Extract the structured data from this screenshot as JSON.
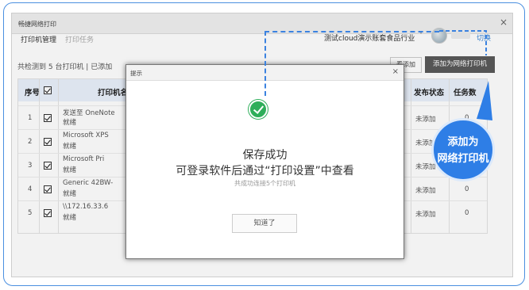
{
  "window": {
    "title": "畅捷网络打印",
    "close": "×"
  },
  "tabs": [
    {
      "label": "打印机管理",
      "active": true
    },
    {
      "label": "打印任务",
      "active": false
    }
  ],
  "account": {
    "name": "测试cloud演示账套食品行业",
    "caret": "˅",
    "switch_label": "切换"
  },
  "summary": "共检测到 5 台打印机 | 已添加",
  "buttons": {
    "check_label": "看添加",
    "add_label": "添加为网络打印机"
  },
  "table": {
    "columns": [
      "序号",
      "",
      "打印机名称",
      "发布状态",
      "任务数"
    ],
    "rows": [
      {
        "index": "1",
        "name": "发送至 OneNote",
        "status": "就绪",
        "publish": "未添加",
        "tasks": "0"
      },
      {
        "index": "2",
        "name": "Microsoft XPS",
        "status": "就绪",
        "publish": "未添加",
        "tasks": "0"
      },
      {
        "index": "3",
        "name": "Microsoft Pri",
        "status": "就绪",
        "publish": "未添加",
        "tasks": "0"
      },
      {
        "index": "4",
        "name": "Generic 42BW-",
        "status": "就绪",
        "publish": "未添加",
        "tasks": "0"
      },
      {
        "index": "5",
        "name": "\\\\172.16.33.6",
        "status": "就绪",
        "publish": "未添加",
        "tasks": "0"
      }
    ]
  },
  "modal": {
    "title": "提示",
    "close": "×",
    "message_line1": "保存成功",
    "message_line2": "可登录软件后通过“打印设置”中查看",
    "message_sub": "共成功连接5个打印机",
    "ok_label": "知道了"
  },
  "callout": {
    "line1": "添加为",
    "line2": "网络打印机"
  },
  "colors": {
    "accent": "#2e7ee6",
    "success": "#2eae5a",
    "link": "#3b87d8"
  }
}
